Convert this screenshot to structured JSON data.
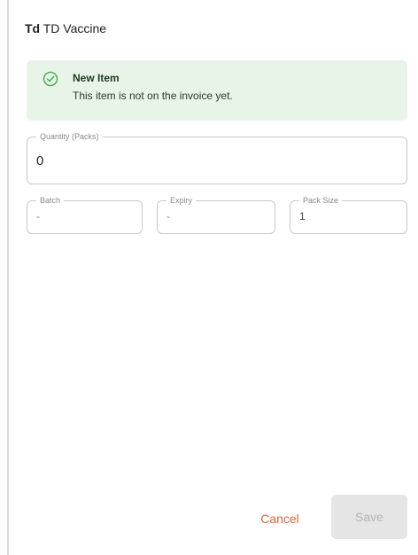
{
  "header": {
    "code": "Td",
    "name": "TD Vaccine"
  },
  "alert": {
    "icon": "check-circle-icon",
    "title": "New Item",
    "message": "This item is not on the invoice yet.",
    "background": "#e8f4e8",
    "accent": "#4caf50"
  },
  "fields": {
    "quantity": {
      "label": "Quantity (Packs)",
      "value": "0"
    },
    "batch": {
      "label": "Batch",
      "value": "-"
    },
    "expiry": {
      "label": "Expiry",
      "value": "-"
    },
    "pack_size": {
      "label": "Pack Size",
      "value": "1"
    }
  },
  "actions": {
    "cancel_label": "Cancel",
    "save_label": "Save",
    "cancel_color": "#e85f3a"
  }
}
